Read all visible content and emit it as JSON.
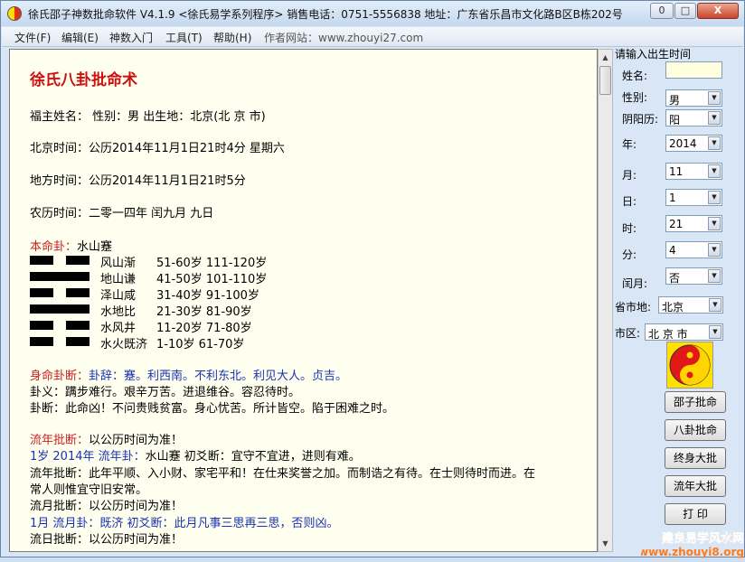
{
  "window": {
    "title": "徐氏邵子神数批命软件 V4.1.9 <徐氏易学系列程序>    销售电话：0751-5556838    地址：广东省乐昌市文化路B区B栋202号",
    "minimize": "0",
    "maximize": "□",
    "close": "X"
  },
  "menu": [
    "文件(F)",
    "编辑(E)",
    "神数入门",
    "工具(T)",
    "帮助(H)",
    "作者网站：www.zhouyi27.com"
  ],
  "content": {
    "heading": "徐氏八卦批命术",
    "owner_line": "福主姓名：  性别：男  出生地：北京(北 京 市)",
    "beijing_time": "北京时间：公历2014年11月1日21时4分 星期六",
    "local_time": "地方时间：公历2014年11月1日21时5分",
    "lunar_time": "农历时间：二零一四年 闰九月 九日",
    "bengua_label": "本命卦：",
    "bengua_value": "水山蹇",
    "gua_rows": [
      {
        "lines": [
          0,
          1
        ],
        "name": "风山渐",
        "ages": "51-60岁  111-120岁"
      },
      {
        "lines": [
          1
        ],
        "name": "地山谦",
        "ages": "41-50岁  101-110岁"
      },
      {
        "lines": [
          0,
          1
        ],
        "name": "泽山咸",
        "ages": "31-40岁  91-100岁"
      },
      {
        "lines": [
          1
        ],
        "name": "水地比",
        "ages": "21-30岁  81-90岁"
      },
      {
        "lines": [
          0,
          1
        ],
        "name": "水风井",
        "ages": "11-20岁  71-80岁"
      },
      {
        "lines": [
          0,
          1
        ],
        "name": "水火既济",
        "ages": "1-10岁    61-70岁"
      }
    ],
    "shenming_label": "身命卦断：",
    "guaci": "卦辞：蹇。利西南。不利东北。利见大人。贞吉。",
    "guayi": "卦义：蹒步难行。艰辛万苦。进退维谷。容忍待时。",
    "guaduan": "卦断：此命凶！不问贵贱贫富。身心忧苦。所计皆空。陷于困难之时。",
    "liunian_label": "流年批断：",
    "liunian_head": "以公历时间为准！",
    "year_line_a": "1岁  2014年  流年卦：",
    "year_line_b": "水山蹇  初爻断：宜守不宜进，进则有难。",
    "liunian_text1": "流年批断：此年平顺、入小财、家宅平和！在仕来奖誉之加。而制诰之有待。在士则待时而进。在",
    "liunian_text2": "常人则惟宜守旧安常。",
    "liuyue_head": "流月批断：以公历时间为准！",
    "month_line": "1月  流月卦：既济  初爻断：此月凡事三思再三思，否则凶。",
    "liuri_head": "流日批断：以公历时间为准！"
  },
  "panel": {
    "prompt": "请输入出生时间",
    "name_label": "姓名:",
    "name_value": "",
    "gender_label": "性别:",
    "gender_value": "男",
    "calendar_label": "阴阳历:",
    "calendar_value": "阳",
    "year_label": "年:",
    "year_value": "2014",
    "month_label": "月:",
    "month_value": "11",
    "day_label": "日:",
    "day_value": "1",
    "hour_label": "时:",
    "hour_value": "21",
    "minute_label": "分:",
    "minute_value": "4",
    "leap_label": "闰月:",
    "leap_value": "否",
    "city_label": "省市地:",
    "city_value": "北京",
    "district_label": "市区:",
    "district_value": "北 京 市",
    "btn_shaozi": "邵子批命",
    "btn_bagua": "八卦批命",
    "btn_zhongshen": "终身大批",
    "btn_liunian": "流年大批",
    "btn_print": "打 印"
  },
  "watermark": {
    "line1": "建良易学风水网",
    "line2": "www.zhouyi8.org"
  },
  "colors": {
    "heading": "#cc1111",
    "label_red": "#c82020",
    "label_blue": "#1a32b0",
    "content_bg": "#fffff0"
  }
}
